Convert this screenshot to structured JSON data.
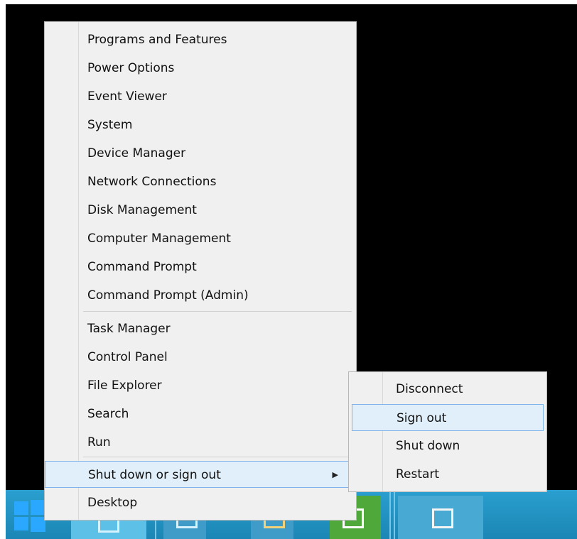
{
  "winx_menu": {
    "items_top": [
      "Programs and Features",
      "Power Options",
      "Event Viewer",
      "System",
      "Device Manager",
      "Network Connections",
      "Disk Management",
      "Computer Management",
      "Command Prompt",
      "Command Prompt (Admin)"
    ],
    "items_middle": [
      "Task Manager",
      "Control Panel",
      "File Explorer",
      "Search",
      "Run"
    ],
    "shutdown_item": "Shut down or sign out",
    "desktop_item": "Desktop",
    "submenu_arrow": "▶"
  },
  "shutdown_submenu": {
    "items": [
      "Disconnect",
      "Sign out",
      "Shut down",
      "Restart"
    ],
    "highlighted": "Sign out"
  },
  "taskbar": {
    "start_icon": "windows-logo-icon",
    "pinned": [
      "server-manager-icon",
      "powershell-icon",
      "file-explorer-icon",
      "tools-icon",
      "notepad-icon"
    ]
  },
  "colors": {
    "menu_bg": "#f0f0f0",
    "highlight_bg": "#e1effa",
    "highlight_border": "#7eb4ea",
    "taskbar": "#2a9fcf"
  }
}
